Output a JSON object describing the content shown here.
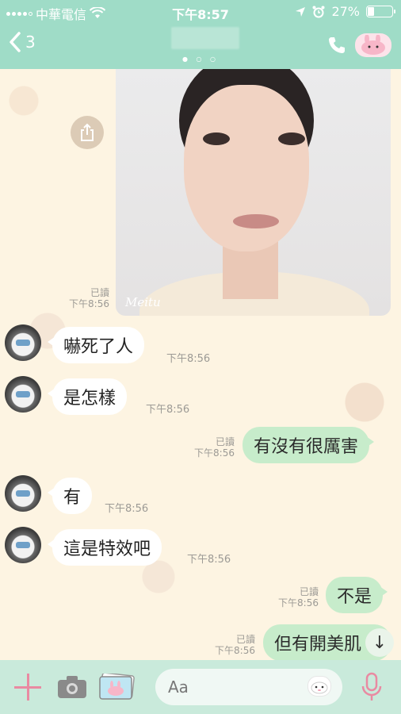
{
  "status_bar": {
    "carrier": "中華電信",
    "time": "下午8:57",
    "battery": "27%",
    "battery_level": 0.27,
    "icons": [
      "signal-icon",
      "wifi-icon",
      "location-icon",
      "alarm-icon",
      "battery-icon"
    ]
  },
  "header": {
    "back_count": "3",
    "page_dots": "● ○ ○",
    "icons": [
      "back-chevron-icon",
      "phone-icon",
      "profile-sticker-icon"
    ]
  },
  "photo_message": {
    "watermark": "Meitu",
    "read": "已讀",
    "time": "下午8:56"
  },
  "messages": [
    {
      "direction": "in",
      "text": "嚇死了人",
      "time": "下午8:56"
    },
    {
      "direction": "in",
      "text": "是怎樣",
      "time": "下午8:56"
    },
    {
      "direction": "out",
      "text": "有沒有很厲害",
      "read": "已讀",
      "time": "下午8:56"
    },
    {
      "direction": "in",
      "text": "有",
      "time": "下午8:56"
    },
    {
      "direction": "in",
      "text": "這是特效吧",
      "time": "下午8:56"
    },
    {
      "direction": "out",
      "text": "不是",
      "read": "已讀",
      "time": "下午8:56"
    },
    {
      "direction": "out",
      "text": "但有開美肌",
      "read": "已讀",
      "time": "下午8:56"
    }
  ],
  "scroll_down": "↓",
  "composer": {
    "placeholder": "Aa",
    "icons": [
      "plus-icon",
      "camera-icon",
      "gallery-icon",
      "sticker-icon",
      "microphone-icon"
    ]
  },
  "colors": {
    "header_bg": "#9fdcc7",
    "chat_bg": "#fdf4e2",
    "incoming_bubble": "#ffffff",
    "outgoing_bubble": "#c7eccb",
    "composer_bg": "#c9eadb",
    "accent_pink": "#e98aa2"
  }
}
